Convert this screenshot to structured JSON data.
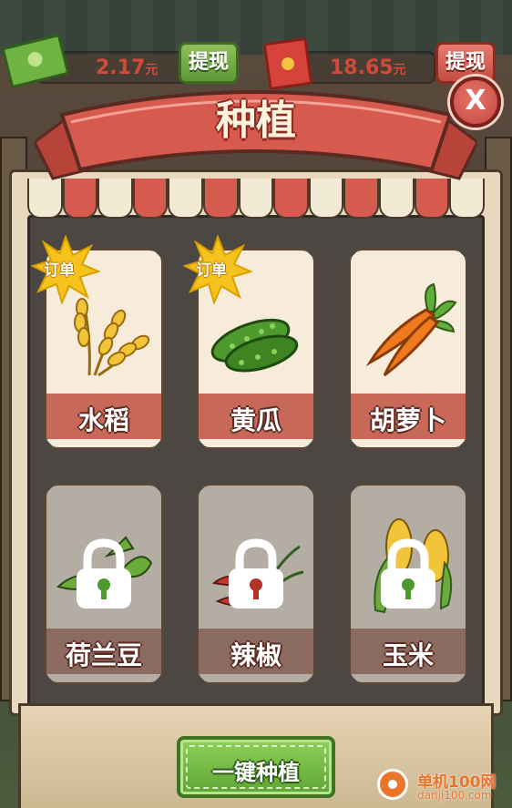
{
  "topbar": {
    "cash": {
      "value": "2.17",
      "unit": "元",
      "withdraw_label": "提现"
    },
    "red_packet": {
      "value": "18.65",
      "unit": "元",
      "withdraw_label": "提现"
    }
  },
  "dialog": {
    "title": "种植",
    "close_label": "X"
  },
  "crops": [
    {
      "name": "水稻",
      "locked": false,
      "badge": "订单",
      "icon": "rice-icon"
    },
    {
      "name": "黄瓜",
      "locked": false,
      "badge": "订单",
      "icon": "cucumber-icon"
    },
    {
      "name": "胡萝卜",
      "locked": false,
      "badge": "",
      "icon": "carrot-icon"
    },
    {
      "name": "荷兰豆",
      "locked": true,
      "badge": "",
      "icon": "pea-icon"
    },
    {
      "name": "辣椒",
      "locked": true,
      "badge": "",
      "icon": "chili-icon"
    },
    {
      "name": "玉米",
      "locked": true,
      "badge": "",
      "icon": "corn-icon"
    }
  ],
  "actions": {
    "plant_all_label": "一键种植"
  },
  "watermark": {
    "name": "单机100网",
    "url": "danji100.com"
  },
  "colors": {
    "ribbon": "#d65a4e",
    "card_label_bar": "#c76858",
    "button_green": "#5ea534",
    "badge_yellow": "#f6c21c"
  }
}
